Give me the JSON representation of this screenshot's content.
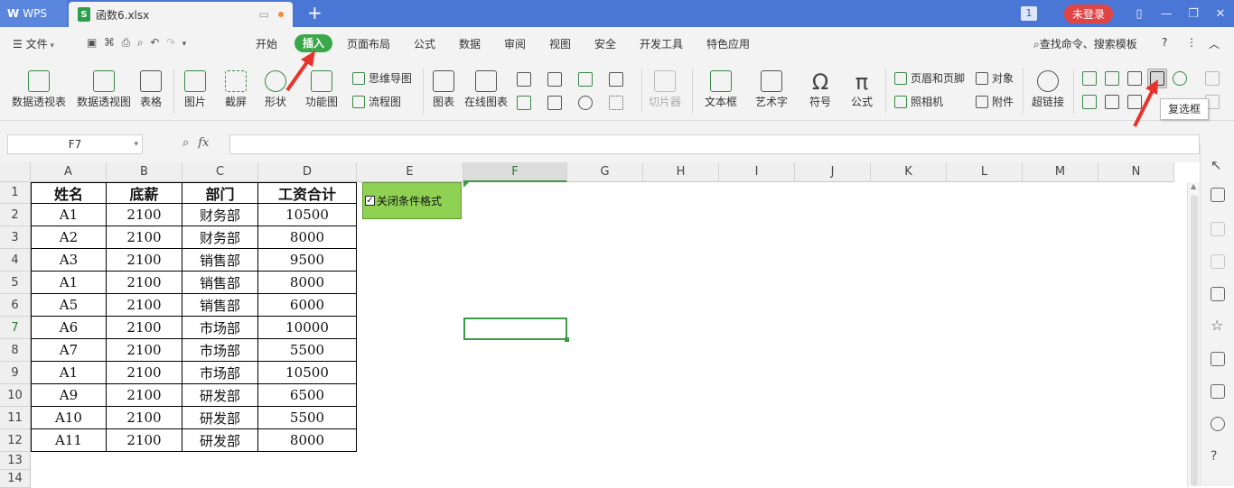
{
  "titlebar": {
    "app_tab": "WPS",
    "file_tab": "函数6.xlsx",
    "new_tab": "+",
    "window_count": "1",
    "login": "未登录"
  },
  "menu": {
    "file": "文件",
    "tabs": [
      "开始",
      "插入",
      "页面布局",
      "公式",
      "数据",
      "审阅",
      "视图",
      "安全",
      "开发工具",
      "特色应用"
    ],
    "active": "插入",
    "search": "查找命令、搜索模板",
    "help": "?"
  },
  "ribbon": {
    "pivot_table": "数据透视表",
    "pivot_chart": "数据透视图",
    "table": "表格",
    "picture": "图片",
    "screenshot": "截屏",
    "shape": "形状",
    "function_chart": "功能图",
    "mindmap": "思维导图",
    "flowchart": "流程图",
    "chart": "图表",
    "online_chart": "在线图表",
    "slicer": "切片器",
    "textbox": "文本框",
    "wordart": "艺术字",
    "symbol": "符号",
    "formula": "公式",
    "header_footer": "页眉和页脚",
    "camera": "照相机",
    "object": "对象",
    "attachment": "附件",
    "hyperlink": "超链接",
    "tooltip": "复选框"
  },
  "formula_bar": {
    "name_box": "F7",
    "fx": "fx",
    "value": ""
  },
  "sheet": {
    "columns": [
      "A",
      "B",
      "C",
      "D",
      "E",
      "F",
      "G",
      "H",
      "I",
      "J",
      "K",
      "L",
      "M",
      "N"
    ],
    "selected_column": "F",
    "rows": [
      "1",
      "2",
      "3",
      "4",
      "5",
      "6",
      "7",
      "8",
      "9",
      "10",
      "11",
      "12",
      "13",
      "14"
    ],
    "selected_row": "7",
    "header": [
      "姓名",
      "底薪",
      "部门",
      "工资合计"
    ],
    "data": [
      [
        "A1",
        "2100",
        "财务部",
        "10500"
      ],
      [
        "A2",
        "2100",
        "财务部",
        "8000"
      ],
      [
        "A3",
        "2100",
        "销售部",
        "9500"
      ],
      [
        "A1",
        "2100",
        "销售部",
        "8000"
      ],
      [
        "A5",
        "2100",
        "销售部",
        "6000"
      ],
      [
        "A6",
        "2100",
        "市场部",
        "10000"
      ],
      [
        "A7",
        "2100",
        "市场部",
        "5500"
      ],
      [
        "A1",
        "2100",
        "市场部",
        "10500"
      ],
      [
        "A9",
        "2100",
        "研发部",
        "6500"
      ],
      [
        "A10",
        "2100",
        "研发部",
        "5500"
      ],
      [
        "A11",
        "2100",
        "研发部",
        "8000"
      ]
    ],
    "checkbox_label": "关闭条件格式",
    "checkbox_checked": true
  },
  "colors": {
    "titlebar": "#4a77d6",
    "accent_green": "#3aa84a",
    "checkbox_fill": "#8fd153",
    "arrow": "#e8322b",
    "login": "#e04545"
  }
}
